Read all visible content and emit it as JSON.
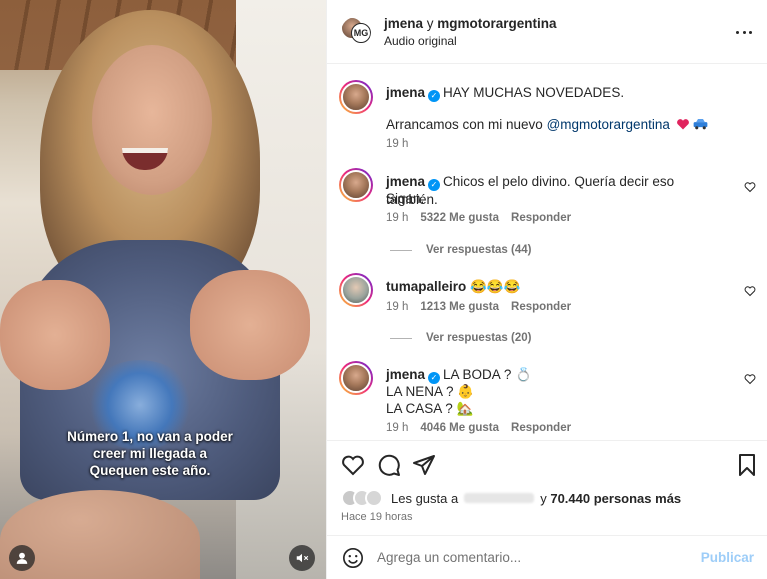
{
  "video": {
    "caption": "Número 1, no van a poder creer mi llegada a Quequen este año."
  },
  "header": {
    "user1": "jmena",
    "joiner": " y ",
    "user2": "mgmotorargentina",
    "subtitle": "Audio original"
  },
  "post": {
    "username": "jmena",
    "line1": "HAY MUCHAS NOVEDADES.",
    "line2_prefix": "Arrancamos con mi nuevo ",
    "mention": "@mgmotorargentina",
    "time": "19 h"
  },
  "comments": [
    {
      "username": "jmena",
      "text_line1": "Chicos el pelo divino. Quería decir eso también.",
      "text_line2": "Sigan.",
      "time": "19 h",
      "likes": "5322 Me gusta",
      "reply": "Responder",
      "view_replies": "Ver respuestas (44)"
    },
    {
      "username": "tumapalleiro",
      "text": "😂😂😂",
      "time": "19 h",
      "likes": "1213 Me gusta",
      "reply": "Responder",
      "view_replies": "Ver respuestas (20)"
    },
    {
      "username": "jmena",
      "text_line1": "LA BODA ? 💍",
      "text_line2": "LA NENA ? 👶",
      "text_line3": "LA CASA ? 🏡",
      "time": "19 h",
      "likes": "4046 Me gusta",
      "reply": "Responder"
    }
  ],
  "likes_summary": {
    "prefix": "Les gusta a",
    "suffix": "y",
    "count": "70.440 personas más"
  },
  "posted_ago": "Hace 19 horas",
  "composer": {
    "placeholder": "Agrega un comentario...",
    "post_label": "Publicar"
  },
  "colors": {
    "verified": "#0095f6",
    "link": "#00376b",
    "muted": "#737373",
    "publish": "#9dcdf8"
  },
  "icons": [
    "more-icon",
    "heart-icon",
    "comment-icon",
    "share-icon",
    "bookmark-icon",
    "emoji-icon",
    "user-icon",
    "mute-icon",
    "verified-icon"
  ]
}
